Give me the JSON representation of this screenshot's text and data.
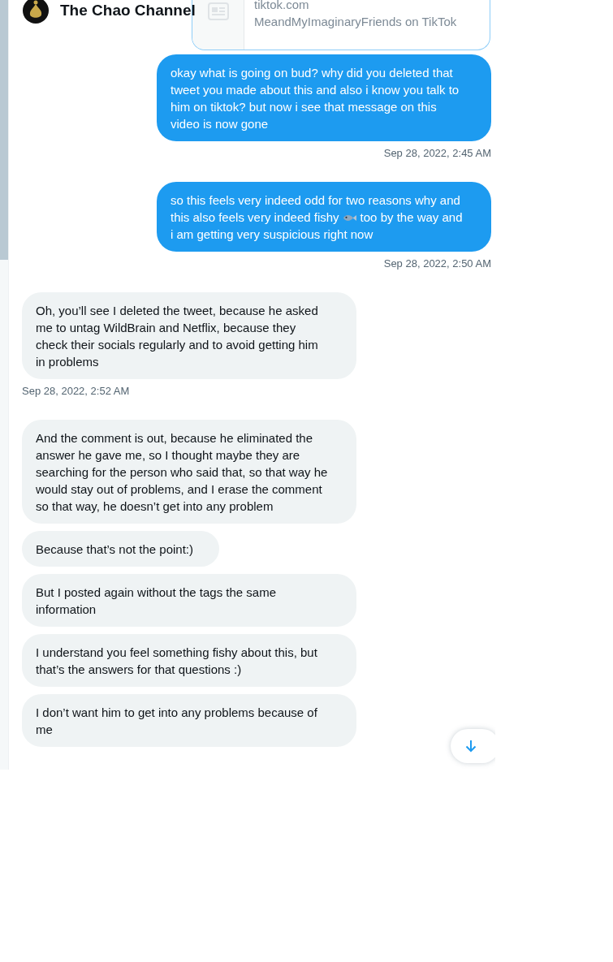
{
  "header": {
    "name": "The Chao Channel"
  },
  "link_card": {
    "domain": "tiktok.com",
    "title": "MeandMyImaginaryFriends on TikTok"
  },
  "messages": [
    {
      "kind": "sent",
      "segments": [
        {
          "kind": "text",
          "text": "okay what is going on bud? why did you deleted that tweet you made about this and also i know you talk to him on tiktok? but now i see that message on this video is now gone"
        }
      ],
      "timestamp": "Sep 28, 2022, 2:45 AM"
    },
    {
      "kind": "sent",
      "segments": [
        {
          "kind": "text",
          "text": "so this feels very indeed odd for two reasons why and this also feels very indeed fishy"
        },
        {
          "kind": "fish-emoji"
        },
        {
          "kind": "text",
          "text": "too by the way and i am getting very suspicious right now"
        }
      ],
      "timestamp": "Sep 28, 2022, 2:50 AM"
    },
    {
      "kind": "received",
      "segments": [
        {
          "kind": "text",
          "text": "Oh, you’ll see I deleted the tweet, because he asked me to untag WildBrain and Netflix, because they check their socials regularly and to avoid getting him in problems"
        }
      ],
      "timestamp": "Sep 28, 2022, 2:52 AM"
    },
    {
      "kind": "received",
      "segments": [
        {
          "kind": "text",
          "text": "And the comment is out, because he eliminated the answer he gave me, so I thought maybe they are searching for the person who said that, so that way he would stay out of problems, and I erase the comment so that way, he doesn’t get into any problem"
        }
      ]
    },
    {
      "kind": "received",
      "segments": [
        {
          "kind": "text",
          "text": "Because that’s not the point:)"
        }
      ]
    },
    {
      "kind": "received",
      "segments": [
        {
          "kind": "text",
          "text": "But I posted again without the tags the same information"
        }
      ]
    },
    {
      "kind": "received",
      "segments": [
        {
          "kind": "text",
          "text": "I understand you feel something fishy about this, but that’s the answers for that questions :)"
        }
      ]
    },
    {
      "kind": "received",
      "segments": [
        {
          "kind": "text",
          "text": "I don’t want him to get into any problems because of me"
        }
      ]
    }
  ]
}
